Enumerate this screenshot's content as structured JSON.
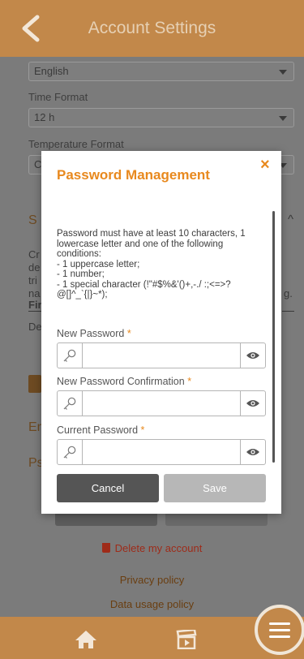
{
  "header": {
    "title": "Account Settings"
  },
  "settings": {
    "language_value": "English",
    "time_format_label": "Time Format",
    "time_format_value": "12 h",
    "temperature_format_label": "Temperature Format",
    "temperature_value_fragment": "C"
  },
  "background_fragments": {
    "section_initial": "S",
    "text_lines": [
      "Cr",
      "de",
      "tri",
      "na"
    ],
    "text_tail": "g.",
    "first_heading_fragment": "Fir",
    "de_fragment": "De",
    "em_fragment": "Em",
    "ps_fragment": "Ps"
  },
  "footer_links": {
    "delete_account": "Delete my account",
    "privacy_policy": "Privacy policy",
    "data_usage_policy": "Data usage policy"
  },
  "modal": {
    "title": "Password Management",
    "close_symbol": "×",
    "rules": "Password must have at least 10 characters, 1 lowercase letter and one of the following conditions:\n- 1 uppercase letter;\n- 1 number;\n- 1 special character (!\"#$%&'()+,-./ :;<=>?@[]^_`{|}~*);",
    "required_marker": "*",
    "fields": [
      {
        "label": "New Password",
        "value": ""
      },
      {
        "label": "New Password Confirmation",
        "value": ""
      },
      {
        "label": "Current Password",
        "value": ""
      }
    ],
    "cancel_label": "Cancel",
    "save_label": "Save"
  },
  "icons": [
    "chevron-left-icon",
    "key-icon",
    "eye-icon",
    "trash-icon",
    "home-icon",
    "clapperboard-icon",
    "menu-icon"
  ],
  "colors": {
    "accent": "#e8891e",
    "header": "#c2884a",
    "overlay_bg": "#7b7b7b"
  }
}
